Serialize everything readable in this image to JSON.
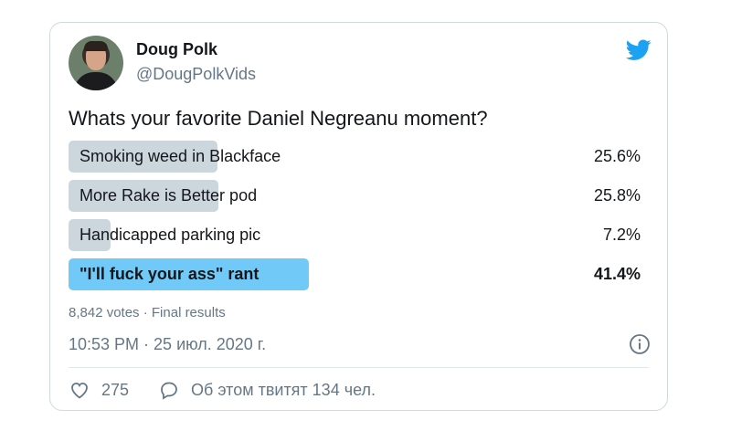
{
  "author": {
    "name": "Doug Polk",
    "handle": "@DougPolkVids"
  },
  "tweet": {
    "question": "Whats your favorite Daniel Negreanu moment?"
  },
  "poll": {
    "options": [
      {
        "label": "Smoking weed in Blackface",
        "percent_text": "25.6%",
        "percent": 25.6,
        "winner": false
      },
      {
        "label": "More Rake is Better pod",
        "percent_text": "25.8%",
        "percent": 25.8,
        "winner": false
      },
      {
        "label": "Handicapped parking pic",
        "percent_text": "7.2%",
        "percent": 7.2,
        "winner": false
      },
      {
        "label": "\"I'll fuck your ass\" rant",
        "percent_text": "41.4%",
        "percent": 41.4,
        "winner": true
      }
    ],
    "meta": "8,842 votes · Final results"
  },
  "timestamp": "10:53 PM · 25 июл. 2020 г.",
  "actions": {
    "like_count": "275",
    "talking_text": "Об этом твитят 134 чел."
  },
  "colors": {
    "bar": "#ccd6dd",
    "winner_bar": "#71c9f8",
    "twitter_blue": "#1da1f2"
  },
  "icons": [
    "twitter-bird-icon",
    "info-icon",
    "heart-icon",
    "reply-icon"
  ]
}
